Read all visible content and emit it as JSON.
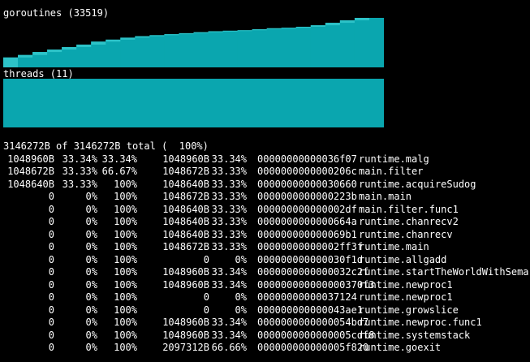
{
  "goroutines": {
    "label": "goroutines (33519)",
    "color": "#0aa6af",
    "highlight": "#2dc3c8",
    "steps": [
      0.2,
      0.25,
      0.31,
      0.36,
      0.41,
      0.46,
      0.52,
      0.56,
      0.6,
      0.63,
      0.65,
      0.67,
      0.69,
      0.71,
      0.73,
      0.74,
      0.75,
      0.77,
      0.79,
      0.8,
      0.82,
      0.85,
      0.9,
      0.95,
      1.0,
      1.0
    ]
  },
  "threads": {
    "label": "threads (11)",
    "color": "#0aa6af"
  },
  "profile": {
    "summary": "3146272B of 3146272B total (  100%)",
    "rows": [
      [
        "1048960B",
        "33.34%",
        "33.34%",
        "1048960B",
        "33.34%",
        "00000000000036f07",
        "runtime.malg"
      ],
      [
        "1048672B",
        "33.33%",
        "66.67%",
        "1048672B",
        "33.33%",
        "0000000000000206c",
        "main.filter"
      ],
      [
        "1048640B",
        "33.33%",
        "100%",
        "1048640B",
        "33.33%",
        "00000000000030660",
        "runtime.acquireSudog"
      ],
      [
        "0",
        "0%",
        "100%",
        "1048672B",
        "33.33%",
        "0000000000000223b",
        "main.main"
      ],
      [
        "0",
        "0%",
        "100%",
        "1048640B",
        "33.33%",
        "000000000000002df",
        "main.filter.func1"
      ],
      [
        "0",
        "0%",
        "100%",
        "1048640B",
        "33.33%",
        "0000000000000664a",
        "runtime.chanrecv2"
      ],
      [
        "0",
        "0%",
        "100%",
        "1048640B",
        "33.33%",
        "000000000000069b1",
        "runtime.chanrecv"
      ],
      [
        "0",
        "0%",
        "100%",
        "1048672B",
        "33.33%",
        "00000000000002ff3f",
        "runtime.main"
      ],
      [
        "0",
        "0%",
        "100%",
        "0",
        "0%",
        "000000000000030f1d",
        "runtime.allgadd"
      ],
      [
        "0",
        "0%",
        "100%",
        "1048960B",
        "33.34%",
        "0000000000000032c2f",
        "runtime.startTheWorldWithSema"
      ],
      [
        "0",
        "0%",
        "100%",
        "1048960B",
        "33.34%",
        "000000000000000370f3",
        "runtime.newproc1"
      ],
      [
        "0",
        "0%",
        "100%",
        "0",
        "0%",
        "00000000000037124",
        "runtime.newproc1"
      ],
      [
        "0",
        "0%",
        "100%",
        "0",
        "0%",
        "000000000000043ae1",
        "runtime.growslice"
      ],
      [
        "0",
        "0%",
        "100%",
        "1048960B",
        "33.34%",
        "0000000000000054bd7",
        "runtime.newproc.func1"
      ],
      [
        "0",
        "0%",
        "100%",
        "1048960B",
        "33.34%",
        "0000000000000005cdf8",
        "runtime.systemstack"
      ],
      [
        "0",
        "0%",
        "100%",
        "2097312B",
        "66.66%",
        "000000000000005f820",
        "runtime.goexit"
      ]
    ]
  }
}
